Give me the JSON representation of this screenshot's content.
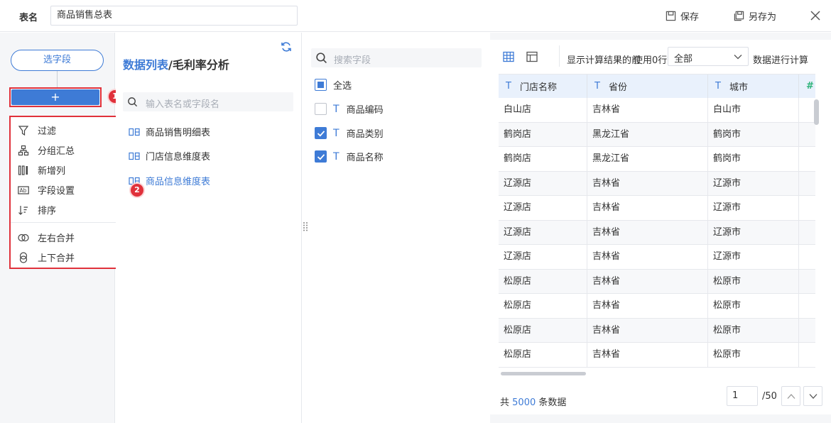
{
  "header": {
    "name_label": "表名",
    "name_value": "商品销售总表",
    "save_label": "保存",
    "save_as_label": "另存为"
  },
  "steps": {
    "select_field_label": "选字段",
    "add_label": "+",
    "badge1": "1",
    "badge2": "2",
    "menu": [
      {
        "label": "过滤",
        "icon": "filter-icon"
      },
      {
        "label": "分组汇总",
        "icon": "group-icon"
      },
      {
        "label": "新增列",
        "icon": "add-column-icon"
      },
      {
        "label": "字段设置",
        "icon": "field-settings-icon"
      },
      {
        "label": "排序",
        "icon": "sort-icon"
      },
      {
        "label": "左右合并",
        "icon": "merge-horizontal-icon"
      },
      {
        "label": "上下合并",
        "icon": "merge-vertical-icon"
      }
    ]
  },
  "tables": {
    "title_highlight": "数据列表",
    "title_rest": "/毛利率分析",
    "search_placeholder": "输入表名或字段名",
    "items": [
      {
        "label": "商品销售明细表",
        "active": false
      },
      {
        "label": "门店信息维度表",
        "active": false
      },
      {
        "label": "商品信息维度表",
        "active": true
      }
    ]
  },
  "fields": {
    "search_placeholder": "搜索字段",
    "select_all": "全选",
    "type_glyph": "T",
    "items": [
      {
        "label": "商品编码",
        "checked": false
      },
      {
        "label": "商品类别",
        "checked": true
      },
      {
        "label": "商品名称",
        "checked": true
      }
    ]
  },
  "preview": {
    "show_label": "显示计算结果的前",
    "overlap_text": "使用0行数据",
    "select_value": "全部",
    "after_select": "数据进行计算",
    "columns": [
      {
        "label": "门店名称",
        "type": "T"
      },
      {
        "label": "省份",
        "type": "T"
      },
      {
        "label": "城市",
        "type": "T"
      },
      {
        "label": "",
        "type": "#"
      }
    ],
    "rows": [
      [
        "白山店",
        "吉林省",
        "白山市"
      ],
      [
        "鹤岗店",
        "黑龙江省",
        "鹤岗市"
      ],
      [
        "鹤岗店",
        "黑龙江省",
        "鹤岗市"
      ],
      [
        "辽源店",
        "吉林省",
        "辽源市"
      ],
      [
        "辽源店",
        "吉林省",
        "辽源市"
      ],
      [
        "辽源店",
        "吉林省",
        "辽源市"
      ],
      [
        "辽源店",
        "吉林省",
        "辽源市"
      ],
      [
        "松原店",
        "吉林省",
        "松原市"
      ],
      [
        "松原店",
        "吉林省",
        "松原市"
      ],
      [
        "松原店",
        "吉林省",
        "松原市"
      ],
      [
        "松原店",
        "吉林省",
        "松原市"
      ]
    ],
    "total_prefix": "共",
    "total_count": "5000",
    "total_suffix": "条数据",
    "page_value": "1",
    "page_total": "/50"
  },
  "colors": {
    "accent": "#3e7bd6",
    "highlight_border": "#e0313b",
    "number_type": "#2fb37a"
  }
}
